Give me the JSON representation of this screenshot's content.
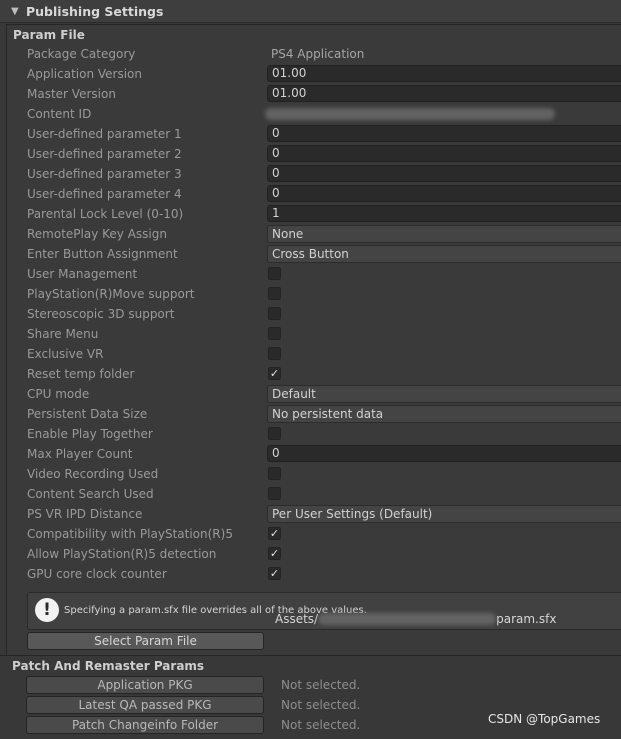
{
  "header": {
    "title": "Publishing Settings",
    "arrow_glyph": "▼"
  },
  "param_file": {
    "group_label": "Param File",
    "rows": [
      {
        "label": "Package Category",
        "kind": "plain",
        "value": "PS4 Application"
      },
      {
        "label": "Application Version",
        "kind": "field",
        "value": "01.00"
      },
      {
        "label": "Master Version",
        "kind": "field",
        "value": "01.00"
      },
      {
        "label": "Content ID",
        "kind": "redacted",
        "value": ""
      },
      {
        "label": "User-defined parameter 1",
        "kind": "field",
        "value": "0"
      },
      {
        "label": "User-defined parameter 2",
        "kind": "field",
        "value": "0"
      },
      {
        "label": "User-defined parameter 3",
        "kind": "field",
        "value": "0"
      },
      {
        "label": "User-defined parameter 4",
        "kind": "field",
        "value": "0"
      },
      {
        "label": "Parental Lock Level (0-10)",
        "kind": "field",
        "value": "1"
      },
      {
        "label": "RemotePlay Key Assign",
        "kind": "dropdown",
        "value": "None"
      },
      {
        "label": "Enter Button Assignment",
        "kind": "dropdown",
        "value": "Cross Button"
      },
      {
        "label": "User Management",
        "kind": "checkbox",
        "checked": false
      },
      {
        "label": "PlayStation(R)Move support",
        "kind": "checkbox",
        "checked": false
      },
      {
        "label": "Stereoscopic 3D support",
        "kind": "checkbox",
        "checked": false
      },
      {
        "label": "Share Menu",
        "kind": "checkbox",
        "checked": false
      },
      {
        "label": "Exclusive VR",
        "kind": "checkbox",
        "checked": false
      },
      {
        "label": "Reset temp folder",
        "kind": "checkbox",
        "checked": true
      },
      {
        "label": "CPU mode",
        "kind": "dropdown",
        "value": "Default"
      },
      {
        "label": "Persistent Data Size",
        "kind": "dropdown",
        "value": "No persistent data"
      },
      {
        "label": "Enable Play Together",
        "kind": "checkbox",
        "checked": false
      },
      {
        "label": "Max Player Count",
        "kind": "field",
        "value": "0"
      },
      {
        "label": "Video Recording Used",
        "kind": "checkbox",
        "checked": false
      },
      {
        "label": "Content Search Used",
        "kind": "checkbox",
        "checked": false
      },
      {
        "label": "PS VR IPD Distance",
        "kind": "dropdown",
        "value": "Per User Settings (Default)"
      },
      {
        "label": "Compatibility with PlayStation(R)5",
        "kind": "checkbox",
        "checked": true
      },
      {
        "label": "Allow PlayStation(R)5 detection",
        "kind": "checkbox",
        "checked": true
      },
      {
        "label": "GPU core clock counter",
        "kind": "checkbox",
        "checked": true
      }
    ],
    "help_text": "Specifying a param.sfx file overrides all of the above values.",
    "help_icon_glyph": "!",
    "check_glyph": "✓",
    "select_button": "Select Param File",
    "path_prefix": "Assets/",
    "path_suffix": "param.sfx"
  },
  "patch": {
    "title": "Patch And Remaster Params",
    "rows": [
      {
        "button": "Application PKG",
        "status": "Not selected."
      },
      {
        "button": "Latest QA passed PKG",
        "status": "Not selected."
      },
      {
        "button": "Patch Changeinfo Folder",
        "status": "Not selected."
      }
    ]
  },
  "watermark": "CSDN @TopGames"
}
